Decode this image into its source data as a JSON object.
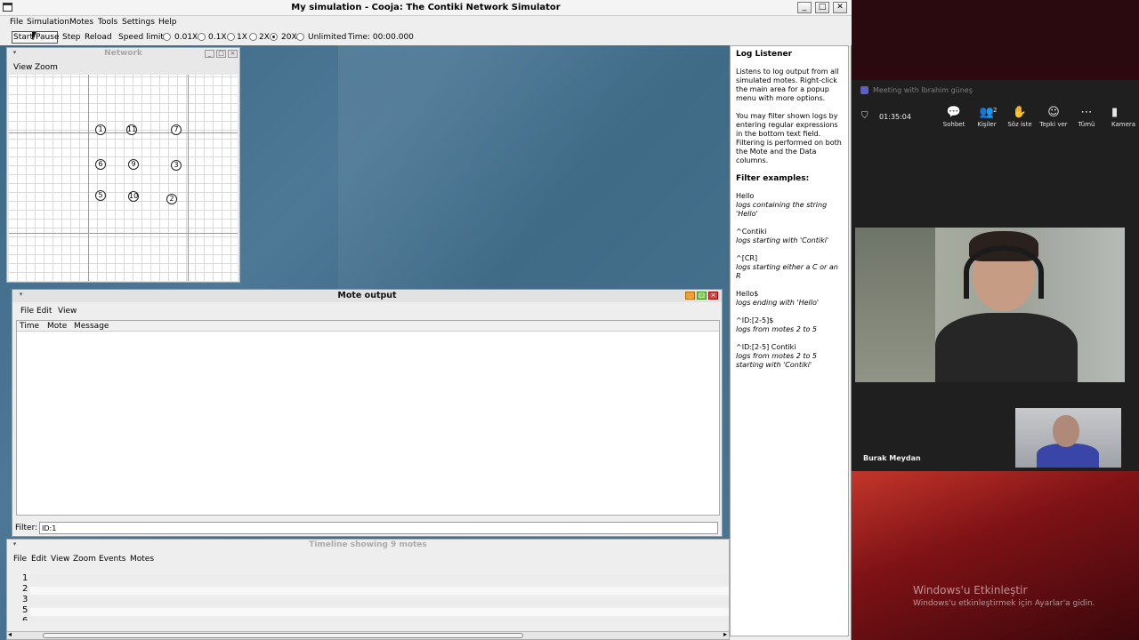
{
  "cooja": {
    "window_title": "My simulation - Cooja: The Contiki Network Simulator",
    "menu": [
      "File",
      "Simulation",
      "Motes",
      "Tools",
      "Settings",
      "Help"
    ],
    "toolbar": {
      "start_pause": "Start/Pause",
      "step": "Step",
      "reload": "Reload",
      "speed_label": "Speed limit:",
      "speeds": [
        "0.01X",
        "0.1X",
        "1X",
        "2X",
        "20X",
        "Unlimited"
      ],
      "selected_speed": "20X",
      "time": "Time: 00:00.000"
    },
    "network": {
      "title": "Network",
      "menu": [
        "View",
        "Zoom"
      ],
      "motes": [
        "1",
        "11",
        "7",
        "6",
        "9",
        "3",
        "5",
        "10",
        "2"
      ]
    },
    "mote_output": {
      "title": "Mote output",
      "menu": [
        "File",
        "Edit",
        "View"
      ],
      "columns": [
        "Time",
        "Mote",
        "Message"
      ],
      "filter_label": "Filter:",
      "filter_value": "ID:1"
    },
    "timeline": {
      "title": "Timeline showing 9 motes",
      "menu": [
        "File",
        "Edit",
        "View",
        "Zoom",
        "Events",
        "Motes"
      ],
      "rows": [
        "1",
        "2",
        "3",
        "5",
        "6"
      ]
    },
    "log_listener": {
      "title": "Log Listener",
      "para1": "Listens to log output from all simulated motes. Right-click the main area for a popup menu with more options.",
      "para2": "You may filter shown logs by entering regular expressions in the bottom text field. Filtering is performed on both the Mote and the Data columns.",
      "examples_title": "Filter examples:",
      "examples": [
        {
          "expr": "Hello",
          "desc": "logs containing the string 'Hello'"
        },
        {
          "expr": "^Contiki",
          "desc": "logs starting with 'Contiki'"
        },
        {
          "expr": "^[CR]",
          "desc": "logs starting either a C or an R"
        },
        {
          "expr": "Hello$",
          "desc": "logs ending with 'Hello'"
        },
        {
          "expr": "^ID:[2-5]$",
          "desc": "logs from motes 2 to 5"
        },
        {
          "expr": "^ID:[2-5] Contiki",
          "desc": "logs from motes 2 to 5 starting with 'Contiki'"
        }
      ]
    }
  },
  "meeting": {
    "title": "Meeting with İbrahim güneş",
    "timer": "01:35:04",
    "tools": [
      {
        "icon": "chat-icon",
        "glyph": "💬",
        "label": "Sohbet"
      },
      {
        "icon": "people-icon",
        "glyph": "👥",
        "label": "Kişiler"
      },
      {
        "icon": "raise-hand-icon",
        "glyph": "✋",
        "label": "Söz iste"
      },
      {
        "icon": "react-icon",
        "glyph": "☺",
        "label": "Tepki ver"
      },
      {
        "icon": "more-icon",
        "glyph": "⋯",
        "label": "Tümü"
      },
      {
        "icon": "camera-icon",
        "glyph": "▮",
        "label": "Kamera"
      }
    ],
    "participants_count": "2",
    "participant_name": "Burak Meydan"
  },
  "windows_activation": {
    "line1": "Windows'u Etkinleştir",
    "line2": "Windows'u etkinleştirmek için Ayarlar'a gidin."
  }
}
